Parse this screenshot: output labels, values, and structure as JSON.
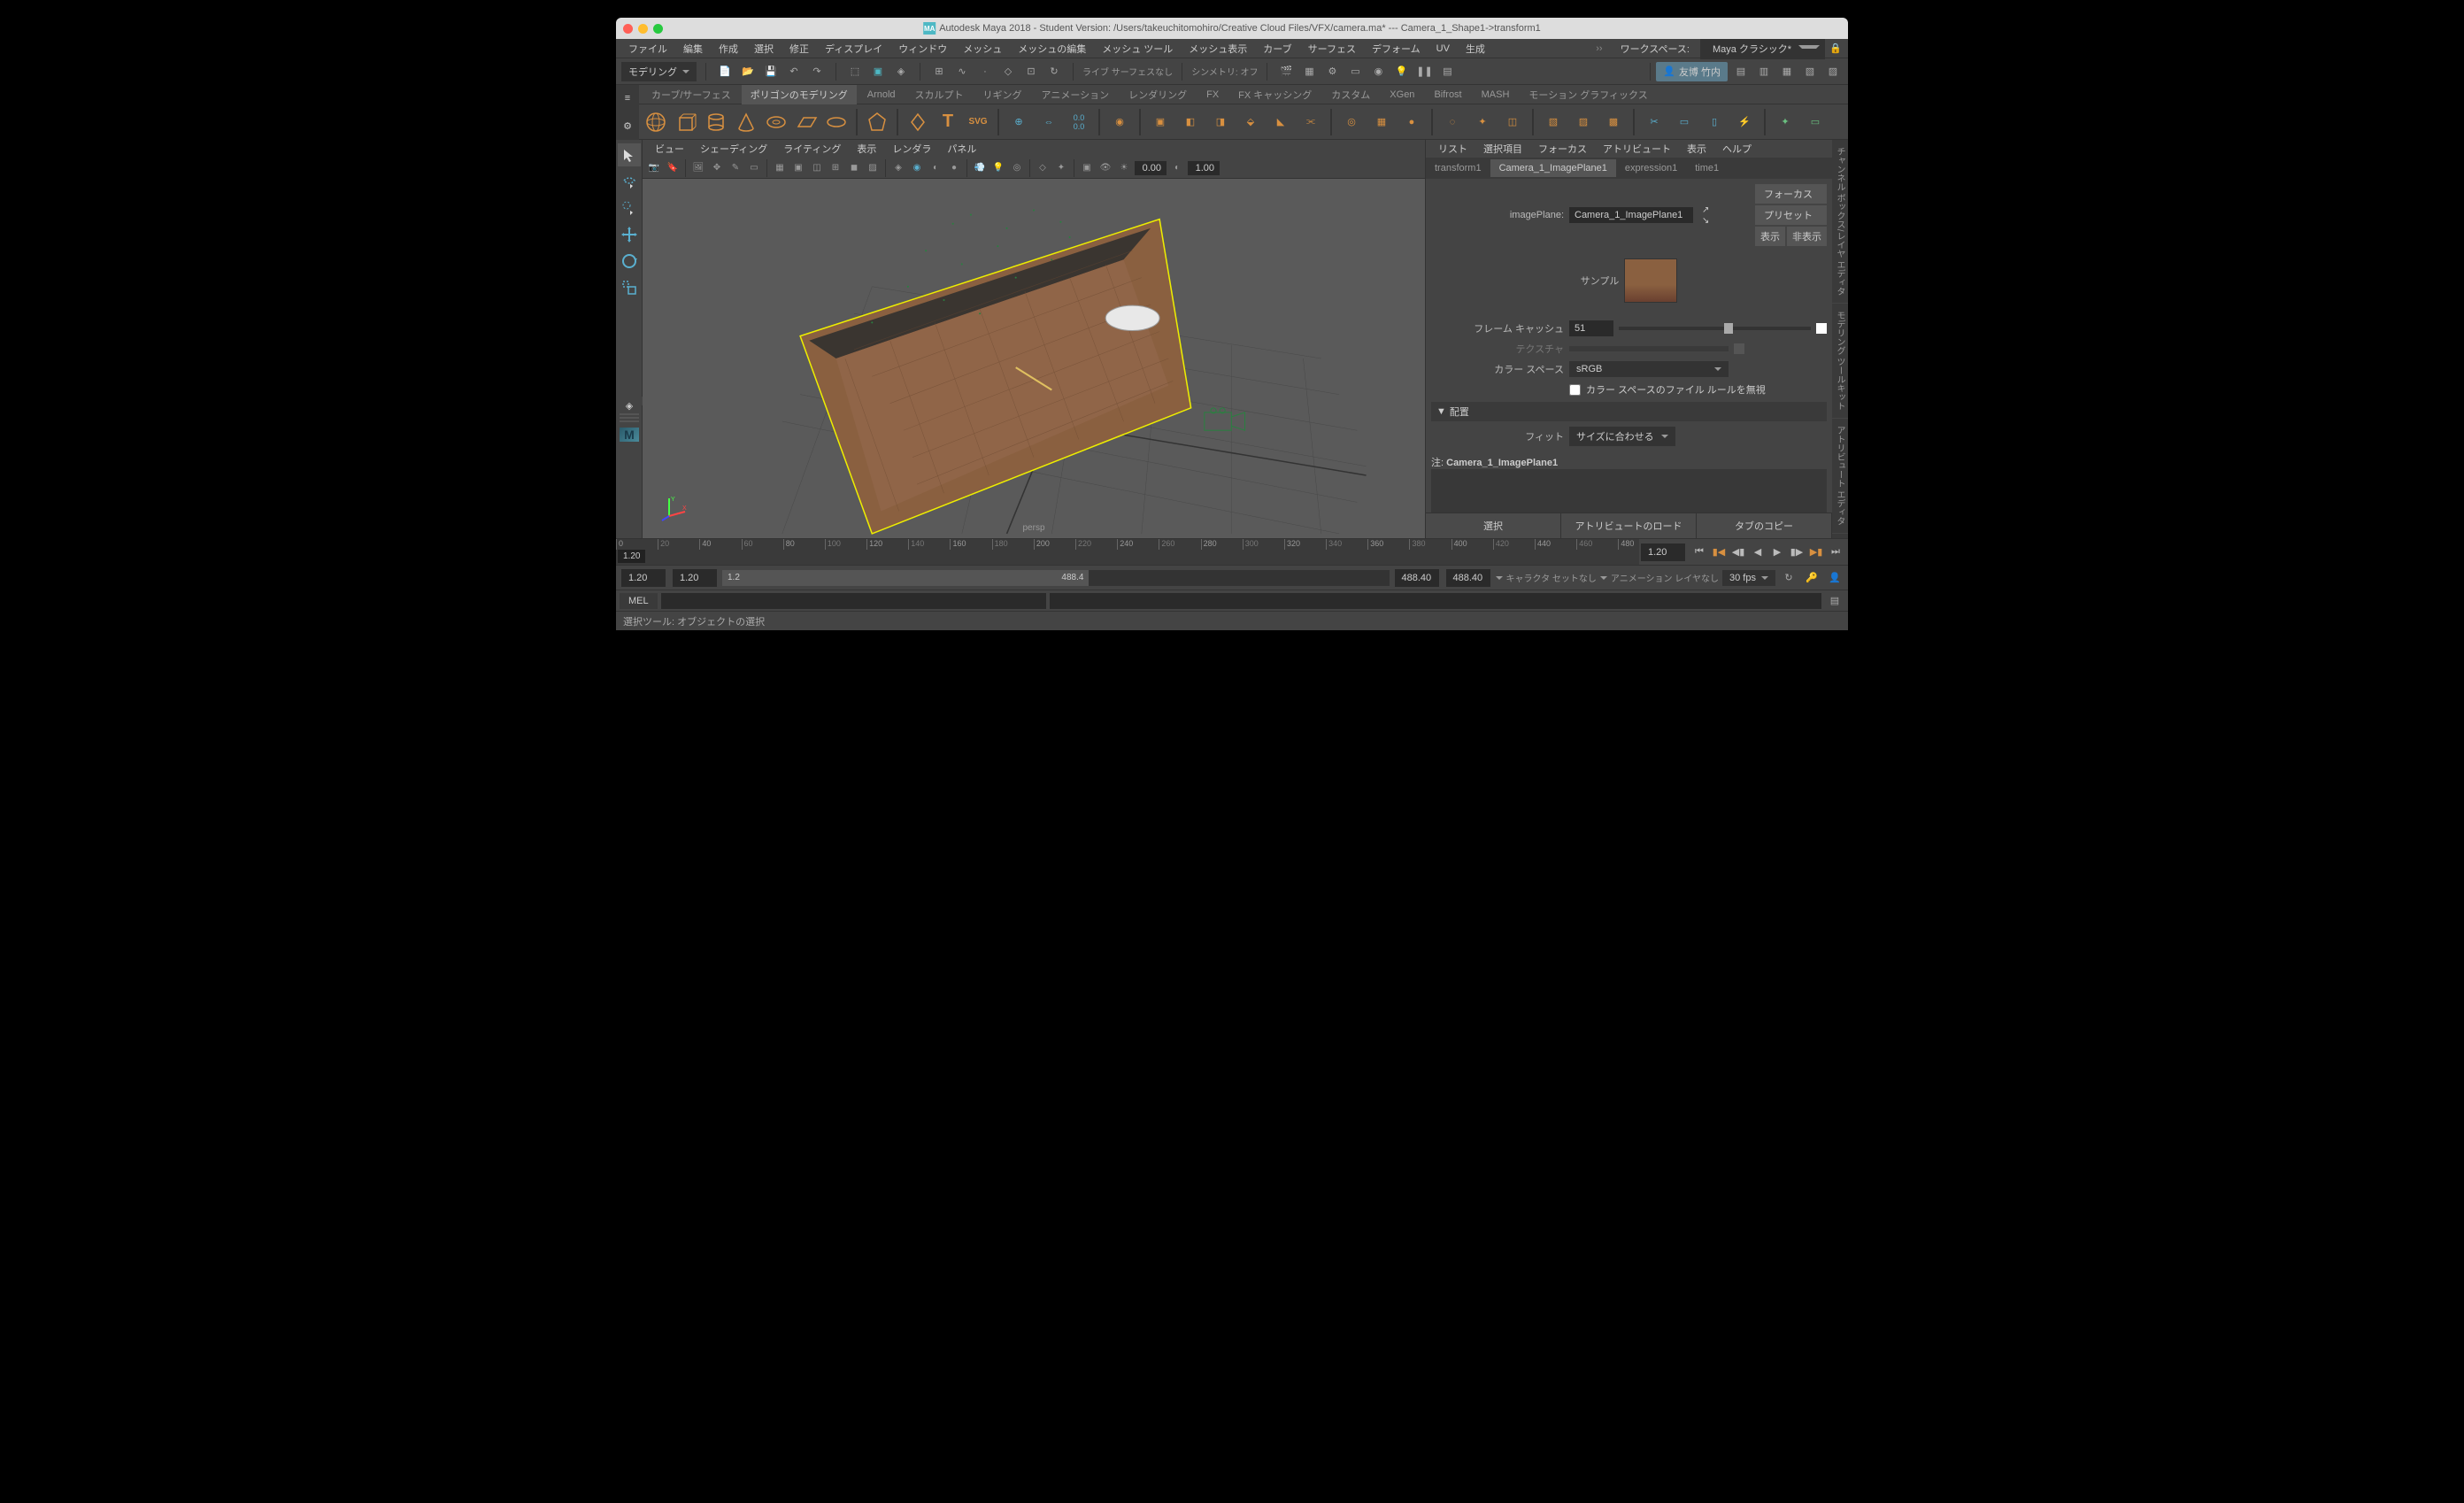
{
  "title": "Autodesk Maya 2018 - Student Version: /Users/takeuchitomohiro/Creative Cloud Files/VFX/camera.ma*  ---  Camera_1_Shape1->transform1",
  "menubar": [
    "ファイル",
    "編集",
    "作成",
    "選択",
    "修正",
    "ディスプレイ",
    "ウィンドウ",
    "メッシュ",
    "メッシュの編集",
    "メッシュ ツール",
    "メッシュ表示",
    "カーブ",
    "サーフェス",
    "デフォーム",
    "UV",
    "生成"
  ],
  "workspace": {
    "label": "ワークスペース:",
    "value": "Maya クラシック*"
  },
  "mode_dropdown": "モデリング",
  "toolbar_text": {
    "live": "ライブ サーフェスなし",
    "sym": "シンメトリ: オフ"
  },
  "user": "友博 竹内",
  "shelf_tabs": [
    "カーブ/サーフェス",
    "ポリゴンのモデリング",
    "スカルプト",
    "リギング",
    "アニメーション",
    "レンダリング",
    "FX",
    "FX キャッシング",
    "カスタム",
    "XGen",
    "Bifrost",
    "MASH",
    "モーション グラフィックス"
  ],
  "shelf_arnold": "Arnold",
  "viewport_menu": [
    "ビュー",
    "シェーディング",
    "ライティング",
    "表示",
    "レンダラ",
    "パネル"
  ],
  "viewport_fields": {
    "a": "0.00",
    "b": "1.00"
  },
  "viewport_label": "persp",
  "attr_menu": [
    "リスト",
    "選択項目",
    "フォーカス",
    "アトリビュート",
    "表示",
    "ヘルプ"
  ],
  "attr_tabs": [
    "transform1",
    "Camera_1_ImagePlane1",
    "expression1",
    "time1"
  ],
  "attr_node_label": "imagePlane:",
  "attr_node_value": "Camera_1_ImagePlane1",
  "attr_btns": {
    "focus": "フォーカス",
    "preset": "プリセット",
    "show": "表示",
    "hide": "非表示"
  },
  "attr_sample": "サンプル",
  "attr_frame_cache_label": "フレーム キャッシュ",
  "attr_frame_cache_value": "51",
  "attr_texture": "テクスチャ",
  "attr_colorspace_label": "カラー スペース",
  "attr_colorspace_value": "sRGB",
  "attr_ignore_rules": "カラー スペースのファイル ルールを無視",
  "attr_section": "配置",
  "attr_fit_label": "フィット",
  "attr_fit_value": "サイズに合わせる",
  "attr_note_label": "注:",
  "attr_note_value": "Camera_1_ImagePlane1",
  "attr_buttons": [
    "選択",
    "アトリビュートのロード",
    "タブのコピー"
  ],
  "timeline_ticks": [
    0,
    40,
    80,
    120,
    160,
    200,
    240,
    280,
    320,
    360,
    400,
    440,
    480
  ],
  "timeline_minor": [
    20,
    60,
    100,
    140,
    180,
    220,
    260,
    300,
    340,
    380,
    420,
    460
  ],
  "current_frame": "1.20",
  "time_end_field": "1.20",
  "range": {
    "start": "1.20",
    "end": "1.20",
    "slider_start": "1.2",
    "slider_end": "488.4",
    "f1": "488.40",
    "f2": "488.40"
  },
  "charset_label": "キャラクタ セットなし",
  "anim_layer": "アニメーション レイヤなし",
  "fps": "30 fps",
  "cmd_label": "MEL",
  "helpline": "選択ツール: オブジェクトの選択",
  "right_tabs": [
    "チャンネル ボックス/レイヤ エディタ",
    "モデリング ツールキット",
    "アトリビュート エディタ"
  ]
}
